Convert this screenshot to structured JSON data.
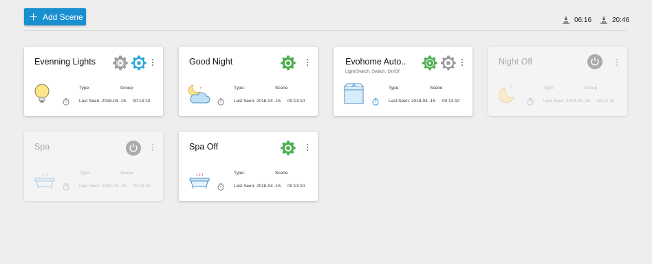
{
  "toolbar": {
    "add_label": "Add Scene",
    "sunrise": "06:16",
    "sunset": "20:46"
  },
  "labels": {
    "type": "Type:",
    "last_seen": "Last Seen: 2018-04 -15",
    "time": "00:13:10"
  },
  "colors": {
    "accent": "#1a8fd0",
    "active_gear": "#4caf50",
    "selected_gear": "#2aa8e0",
    "inactive_gear": "#999999",
    "power_off": "#aaaaaa"
  },
  "cards": [
    {
      "title": "Evenning Lights",
      "subtitle": "",
      "type": "Group",
      "icon": "light-bulb-icon",
      "controls": [
        "play-gear-icon",
        "stop-gear-icon"
      ],
      "enabled": true
    },
    {
      "title": "Good Night",
      "subtitle": "",
      "type": "Scene",
      "icon": "moon-cloud-icon",
      "controls": [
        "activate-gear-icon"
      ],
      "enabled": true
    },
    {
      "title": "Evohome Auto..",
      "subtitle": "Light/Switch, Switch, On/Of",
      "type": "Scene",
      "icon": "box-icon",
      "controls": [
        "play-gear-icon",
        "stop-gear-icon"
      ],
      "enabled": true
    },
    {
      "title": "Night Off",
      "subtitle": "",
      "type": "Group",
      "icon": "moon-stars-icon",
      "controls": [
        "power-icon"
      ],
      "enabled": false
    },
    {
      "title": "Spa",
      "subtitle": "",
      "type": "Scene",
      "icon": "bathtub-icon",
      "controls": [
        "power-icon"
      ],
      "enabled": false
    },
    {
      "title": "Spa Off",
      "subtitle": "",
      "type": "Scene",
      "icon": "bathtub-icon",
      "controls": [
        "activate-gear-icon"
      ],
      "enabled": true
    }
  ]
}
